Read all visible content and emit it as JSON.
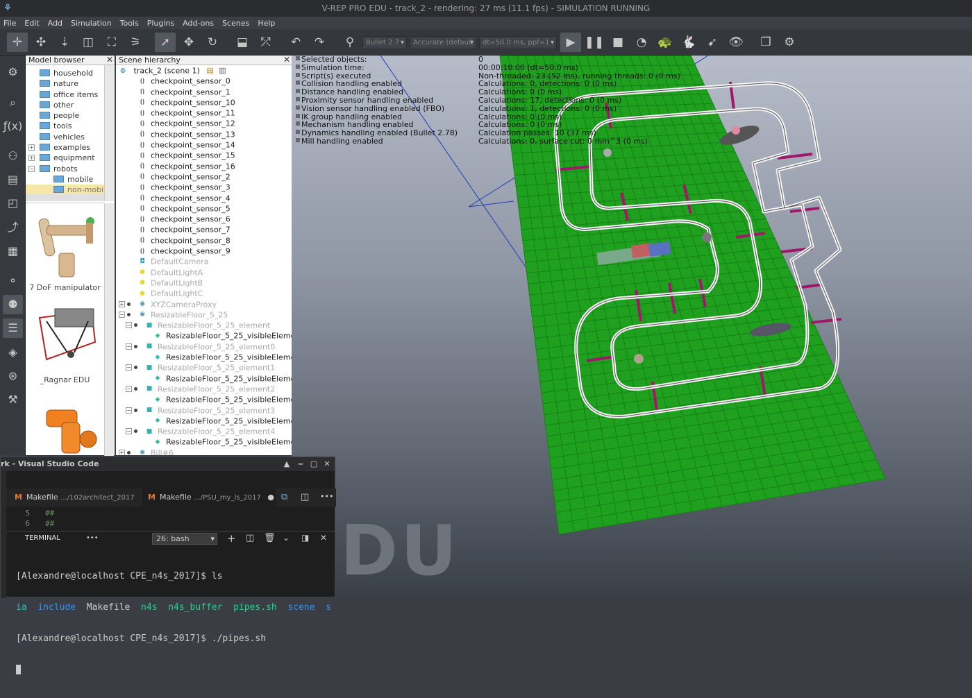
{
  "window": {
    "title": "V-REP PRO EDU - track_2 - rendering: 27 ms (11.1 fps) - SIMULATION RUNNING"
  },
  "menu": [
    "File",
    "Edit",
    "Add",
    "Simulation",
    "Tools",
    "Plugins",
    "Add-ons",
    "Scenes",
    "Help"
  ],
  "toolbar": {
    "engine": "Bullet 2.7",
    "accuracy": "Accurate (default",
    "timestep": "dt=50.0 ms, ppf=1"
  },
  "model_browser": {
    "title": "Model browser",
    "folders": [
      {
        "label": "household",
        "indent": 1
      },
      {
        "label": "nature",
        "indent": 1
      },
      {
        "label": "office items",
        "indent": 1
      },
      {
        "label": "other",
        "indent": 1
      },
      {
        "label": "people",
        "indent": 1
      },
      {
        "label": "tools",
        "indent": 1
      },
      {
        "label": "vehicles",
        "indent": 1
      },
      {
        "label": "examples",
        "indent": 1,
        "expander": "+"
      },
      {
        "label": "equipment",
        "indent": 1,
        "expander": "+"
      },
      {
        "label": "robots",
        "indent": 1,
        "expander": "−"
      },
      {
        "label": "mobile",
        "indent": 2
      },
      {
        "label": "non-mobile",
        "indent": 2,
        "selected": true
      }
    ],
    "thumbs": [
      "7 DoF manipulator",
      "_Ragnar EDU"
    ]
  },
  "scene_hierarchy": {
    "title": "Scene hierarchy",
    "root": "track_2 (scene 1)",
    "items": [
      {
        "label": "checkpoint_sensor_0",
        "depth": 1,
        "icon": "sensor"
      },
      {
        "label": "checkpoint_sensor_1",
        "depth": 1,
        "icon": "sensor"
      },
      {
        "label": "checkpoint_sensor_10",
        "depth": 1,
        "icon": "sensor"
      },
      {
        "label": "checkpoint_sensor_11",
        "depth": 1,
        "icon": "sensor"
      },
      {
        "label": "checkpoint_sensor_12",
        "depth": 1,
        "icon": "sensor"
      },
      {
        "label": "checkpoint_sensor_13",
        "depth": 1,
        "icon": "sensor"
      },
      {
        "label": "checkpoint_sensor_14",
        "depth": 1,
        "icon": "sensor"
      },
      {
        "label": "checkpoint_sensor_15",
        "depth": 1,
        "icon": "sensor"
      },
      {
        "label": "checkpoint_sensor_16",
        "depth": 1,
        "icon": "sensor"
      },
      {
        "label": "checkpoint_sensor_2",
        "depth": 1,
        "icon": "sensor"
      },
      {
        "label": "checkpoint_sensor_3",
        "depth": 1,
        "icon": "sensor"
      },
      {
        "label": "checkpoint_sensor_4",
        "depth": 1,
        "icon": "sensor"
      },
      {
        "label": "checkpoint_sensor_5",
        "depth": 1,
        "icon": "sensor"
      },
      {
        "label": "checkpoint_sensor_6",
        "depth": 1,
        "icon": "sensor"
      },
      {
        "label": "checkpoint_sensor_7",
        "depth": 1,
        "icon": "sensor"
      },
      {
        "label": "checkpoint_sensor_8",
        "depth": 1,
        "icon": "sensor"
      },
      {
        "label": "checkpoint_sensor_9",
        "depth": 1,
        "icon": "sensor"
      },
      {
        "label": "DefaultCamera",
        "depth": 1,
        "icon": "camera",
        "dim": true
      },
      {
        "label": "DefaultLightA",
        "depth": 1,
        "icon": "light",
        "dim": true
      },
      {
        "label": "DefaultLightB",
        "depth": 1,
        "icon": "light",
        "dim": true
      },
      {
        "label": "DefaultLightC",
        "depth": 1,
        "icon": "light",
        "dim": true
      },
      {
        "label": "XYZCameraProxy",
        "depth": 1,
        "icon": "model",
        "dim": true,
        "expander": "+"
      },
      {
        "label": "ResizableFloor_5_25",
        "depth": 1,
        "icon": "model",
        "dim": true,
        "expander": "−"
      },
      {
        "label": "ResizableFloor_5_25_element",
        "depth": 2,
        "icon": "shape",
        "dim": true,
        "expander": "−"
      },
      {
        "label": "ResizableFloor_5_25_visibleEleme",
        "depth": 3,
        "icon": "mesh"
      },
      {
        "label": "ResizableFloor_5_25_element0",
        "depth": 2,
        "icon": "shape",
        "dim": true,
        "expander": "−"
      },
      {
        "label": "ResizableFloor_5_25_visibleEleme",
        "depth": 3,
        "icon": "mesh"
      },
      {
        "label": "ResizableFloor_5_25_element1",
        "depth": 2,
        "icon": "shape",
        "dim": true,
        "expander": "−"
      },
      {
        "label": "ResizableFloor_5_25_visibleEleme",
        "depth": 3,
        "icon": "mesh"
      },
      {
        "label": "ResizableFloor_5_25_element2",
        "depth": 2,
        "icon": "shape",
        "dim": true,
        "expander": "−"
      },
      {
        "label": "ResizableFloor_5_25_visibleEleme",
        "depth": 3,
        "icon": "mesh"
      },
      {
        "label": "ResizableFloor_5_25_element3",
        "depth": 2,
        "icon": "shape",
        "dim": true,
        "expander": "−"
      },
      {
        "label": "ResizableFloor_5_25_visibleEleme",
        "depth": 3,
        "icon": "mesh"
      },
      {
        "label": "ResizableFloor_5_25_element4",
        "depth": 2,
        "icon": "shape",
        "dim": true,
        "expander": "−"
      },
      {
        "label": "ResizableFloor_5_25_visibleEleme",
        "depth": 3,
        "icon": "mesh"
      },
      {
        "label": "Bill#6",
        "depth": 1,
        "icon": "model",
        "dim": true,
        "expander": "+"
      }
    ]
  },
  "sim_info": [
    {
      "key": "Selected objects:",
      "value": "0"
    },
    {
      "key": "Simulation time:",
      "value": "00:00:10.00 (dt=50.0 ms)"
    },
    {
      "key": "Script(s) executed",
      "value": "Non-threaded: 23 (52 ms), running threads: 0 (0 ms)"
    },
    {
      "key": "Collision handling enabled",
      "value": "Calculations: 0, detections: 0 (0 ms)"
    },
    {
      "key": "Distance handling enabled",
      "value": "Calculations: 0 (0 ms)"
    },
    {
      "key": "Proximity sensor handling enabled",
      "value": "Calculations: 17, detections: 0 (0 ms)"
    },
    {
      "key": "Vision sensor handling enabled (FBO)",
      "value": "Calculations: 1, detections: 0 (0 ms)"
    },
    {
      "key": "IK group handling enabled",
      "value": "Calculations: 0 (0 ms)"
    },
    {
      "key": "Mechanism handling enabled",
      "value": "Calculations: 0 (0 ms)"
    },
    {
      "key": "Dynamics handling enabled (Bullet 2.78)",
      "value": "Calculation passes: 10 (37 ms)"
    },
    {
      "key": "Mill handling enabled",
      "value": "Calculations: 0, surface cut: 0 mm^3 (0 ms)"
    }
  ],
  "watermark": "DU",
  "vscode": {
    "title": "rk - Visual Studio Code",
    "tabs": [
      {
        "name": "Makefile",
        "path": ".../102architect_2017"
      },
      {
        "name": "Makefile",
        "path": ".../PSU_my_ls_2017",
        "dirty": "●"
      }
    ],
    "editor_lines": [
      {
        "num": "5",
        "text": "##"
      },
      {
        "num": "6",
        "text": "##"
      }
    ],
    "panel": {
      "label": "TERMINAL",
      "more": "•••",
      "shell": "26: bash"
    },
    "terminal": {
      "line1": "[Alexandre@localhost CPE_n4s_2017]$ ls",
      "ls_items": [
        {
          "text": "ia",
          "color": "#3bb8b8"
        },
        {
          "text": "include",
          "color": "#3b8eea"
        },
        {
          "text": "Makefile",
          "color": "#cccccc"
        },
        {
          "text": "n4s",
          "color": "#23d18b"
        },
        {
          "text": "n4s_buffer",
          "color": "#23d18b"
        },
        {
          "text": "pipes.sh",
          "color": "#23d18b"
        },
        {
          "text": "scene",
          "color": "#3b8eea"
        },
        {
          "text": "s",
          "color": "#3b8eea"
        }
      ],
      "line3": "[Alexandre@localhost CPE_n4s_2017]$ ./pipes.sh"
    }
  },
  "colors": {
    "floor": "#1fa01f",
    "track": "#ffffff",
    "checkpoint": "#a0186a"
  }
}
